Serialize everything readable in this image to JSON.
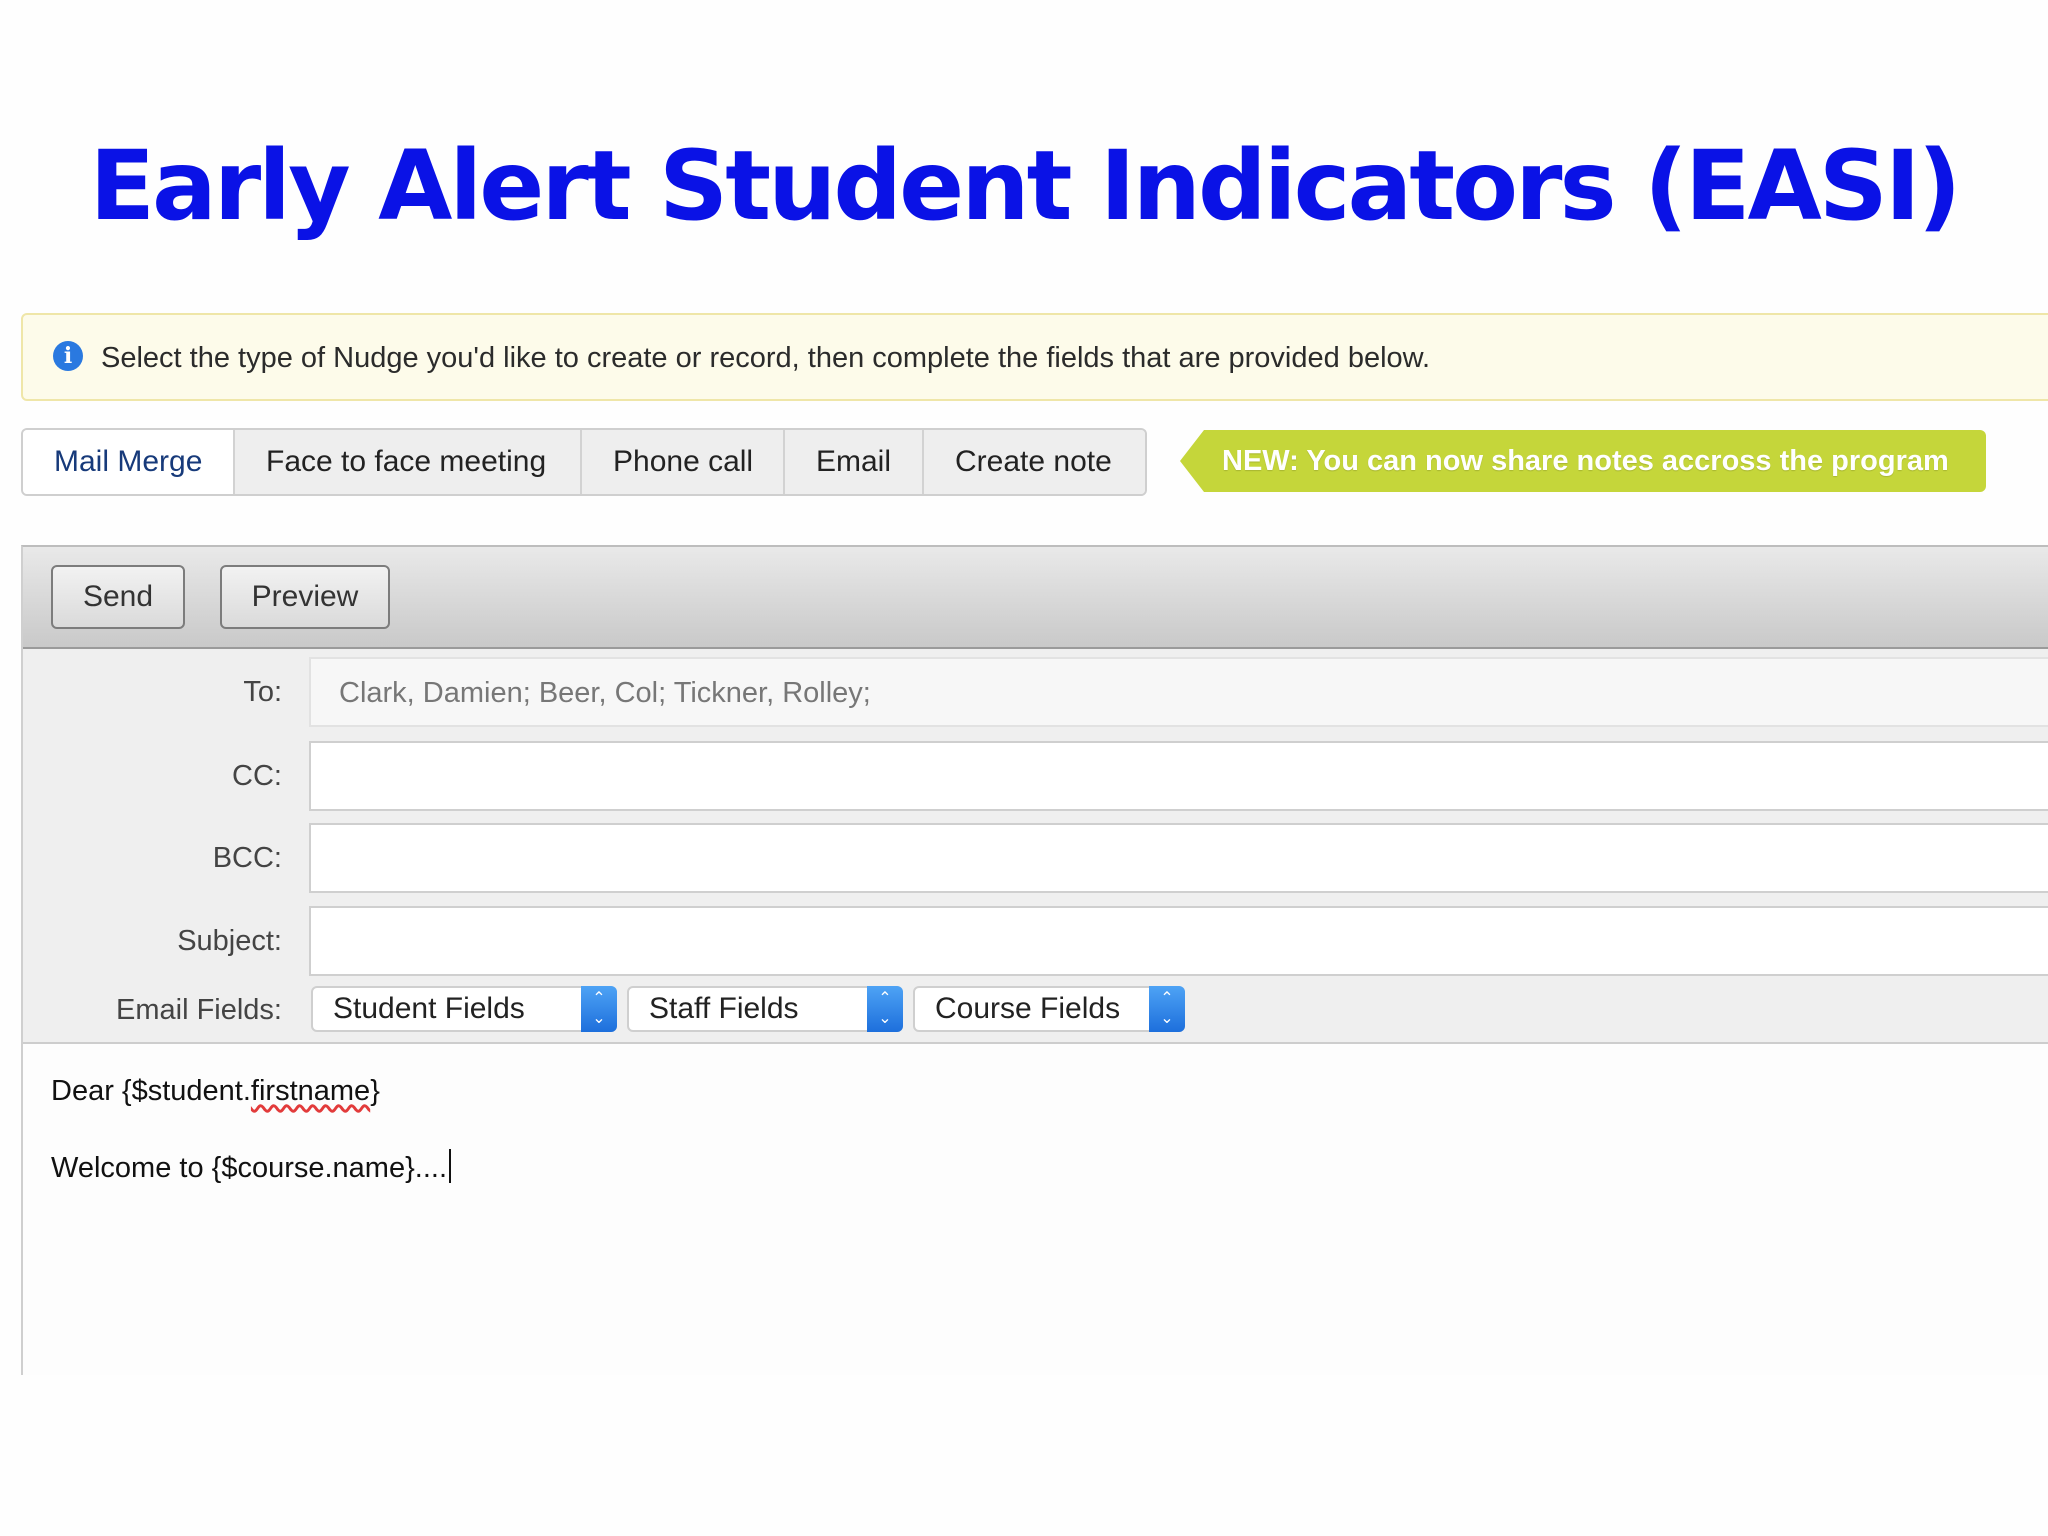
{
  "slide": {
    "title": "Early Alert Student Indicators (EASI)"
  },
  "info_bar": {
    "icon": "info-icon",
    "text": "Select the type of Nudge you'd like to create or record, then complete the fields that are provided below."
  },
  "tabs": [
    {
      "label": "Mail Merge",
      "active": true
    },
    {
      "label": "Face to face meeting",
      "active": false
    },
    {
      "label": "Phone call",
      "active": false
    },
    {
      "label": "Email",
      "active": false
    },
    {
      "label": "Create note",
      "active": false
    }
  ],
  "announcement": {
    "text": "NEW: You can now share notes accross the program",
    "color": "#c5d63a"
  },
  "toolbar": {
    "send_label": "Send",
    "preview_label": "Preview"
  },
  "form": {
    "to_label": "To:",
    "to_value": "Clark, Damien; Beer, Col; Tickner, Rolley;",
    "cc_label": "CC:",
    "cc_value": "",
    "bcc_label": "BCC:",
    "bcc_value": "",
    "subject_label": "Subject:",
    "subject_value": "",
    "email_fields_label": "Email Fields:",
    "selects": [
      {
        "label": "Student Fields"
      },
      {
        "label": "Staff Fields"
      },
      {
        "label": "Course Fields"
      }
    ]
  },
  "message_body": {
    "line1_prefix": "Dear {$student.",
    "line1_misspelled": "firstname",
    "line1_suffix": "}",
    "line2": "Welcome to {$course.name}...."
  },
  "colors": {
    "title": "#0a12e6",
    "info_icon": "#2a79e0",
    "select_spinner": "#1d6fdc"
  }
}
